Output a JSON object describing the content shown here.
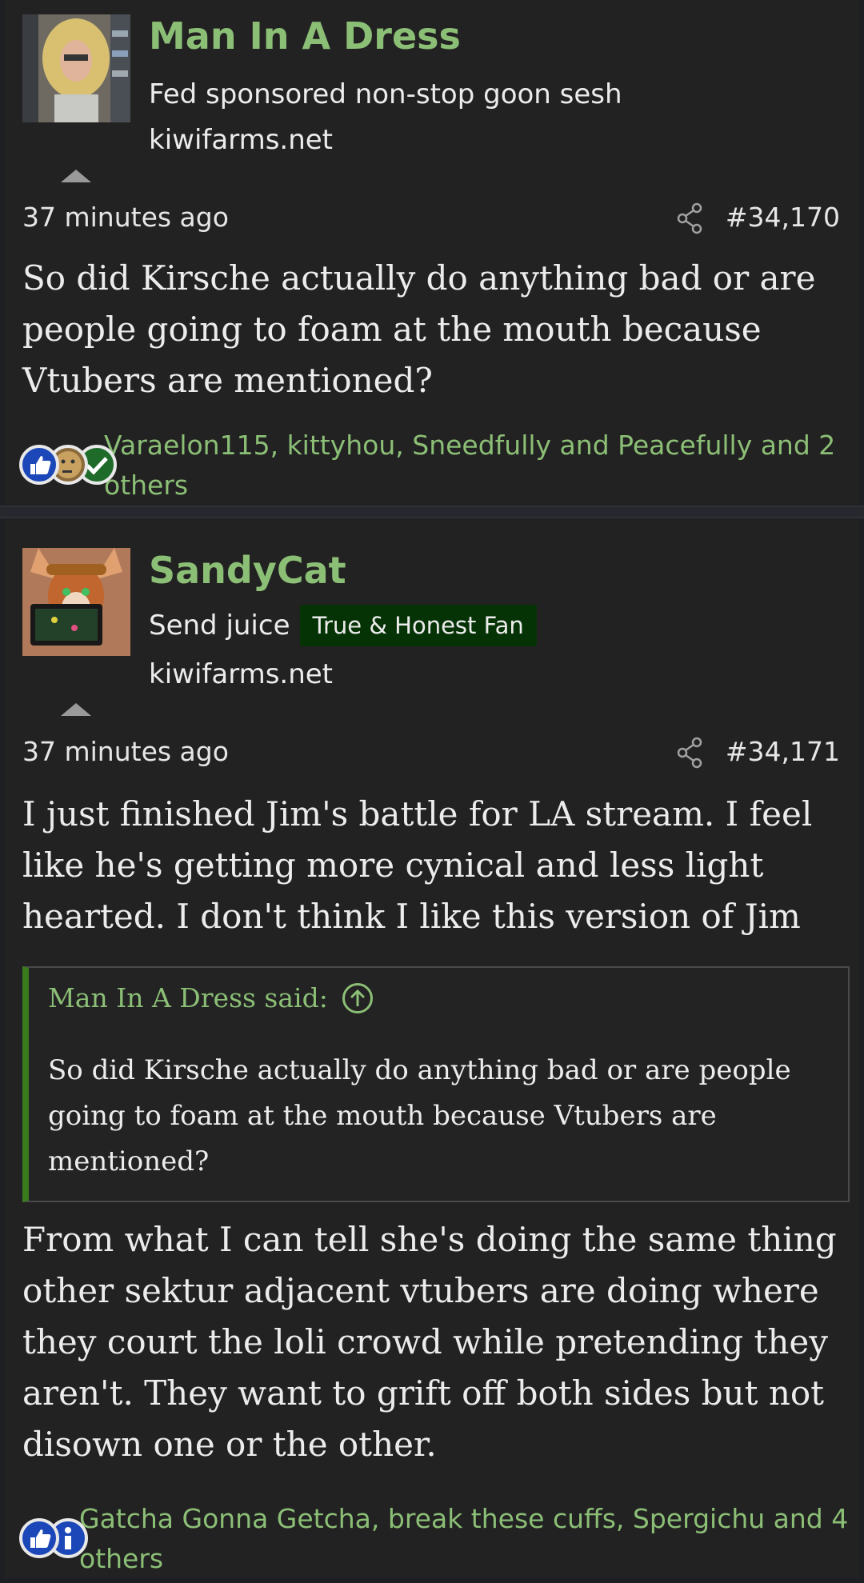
{
  "colors": {
    "accent_green": "#8cbf76",
    "banner_bg": "#063306",
    "quote_border": "#3c7a1e",
    "background": "#222222"
  },
  "posts": [
    {
      "username": "Man In A Dress",
      "user_title": "Fed sponsored non-stop goon sesh",
      "banner": "",
      "site": "kiwifarms.net",
      "timestamp": "37 minutes ago",
      "post_number": "#34,170",
      "body": "So did Kirsche actually do anything bad or are people going to foam at the mouth because Vtubers are mentioned?",
      "reactions": {
        "icons": [
          "like-icon",
          "thinking-icon",
          "agree-icon"
        ],
        "text": "Varaelon115, kittyhou, Sneedfully and Peacefully and 2 others"
      }
    },
    {
      "username": "SandyCat",
      "user_title": "Send juice",
      "banner": "True & Honest Fan",
      "site": "kiwifarms.net",
      "timestamp": "37 minutes ago",
      "post_number": "#34,171",
      "body": "I just finished Jim's battle for LA stream. I feel like he's getting more cynical and less light hearted. I don't think I like this version of Jim",
      "quote": {
        "author": "Man In A Dress said:",
        "text": "So did Kirsche actually do anything bad or are people going to foam at the mouth because Vtubers are mentioned?"
      },
      "body2": "From what I can tell she's doing the same thing other sektur adjacent vtubers are doing where they court the loli crowd while pretending they aren't. They want to grift off both sides but not disown one or the other.",
      "reactions": {
        "icons": [
          "like-icon",
          "informative-icon"
        ],
        "text": "Gatcha Gonna Getcha, break these cuffs, Spergichu and 4 others"
      }
    }
  ]
}
